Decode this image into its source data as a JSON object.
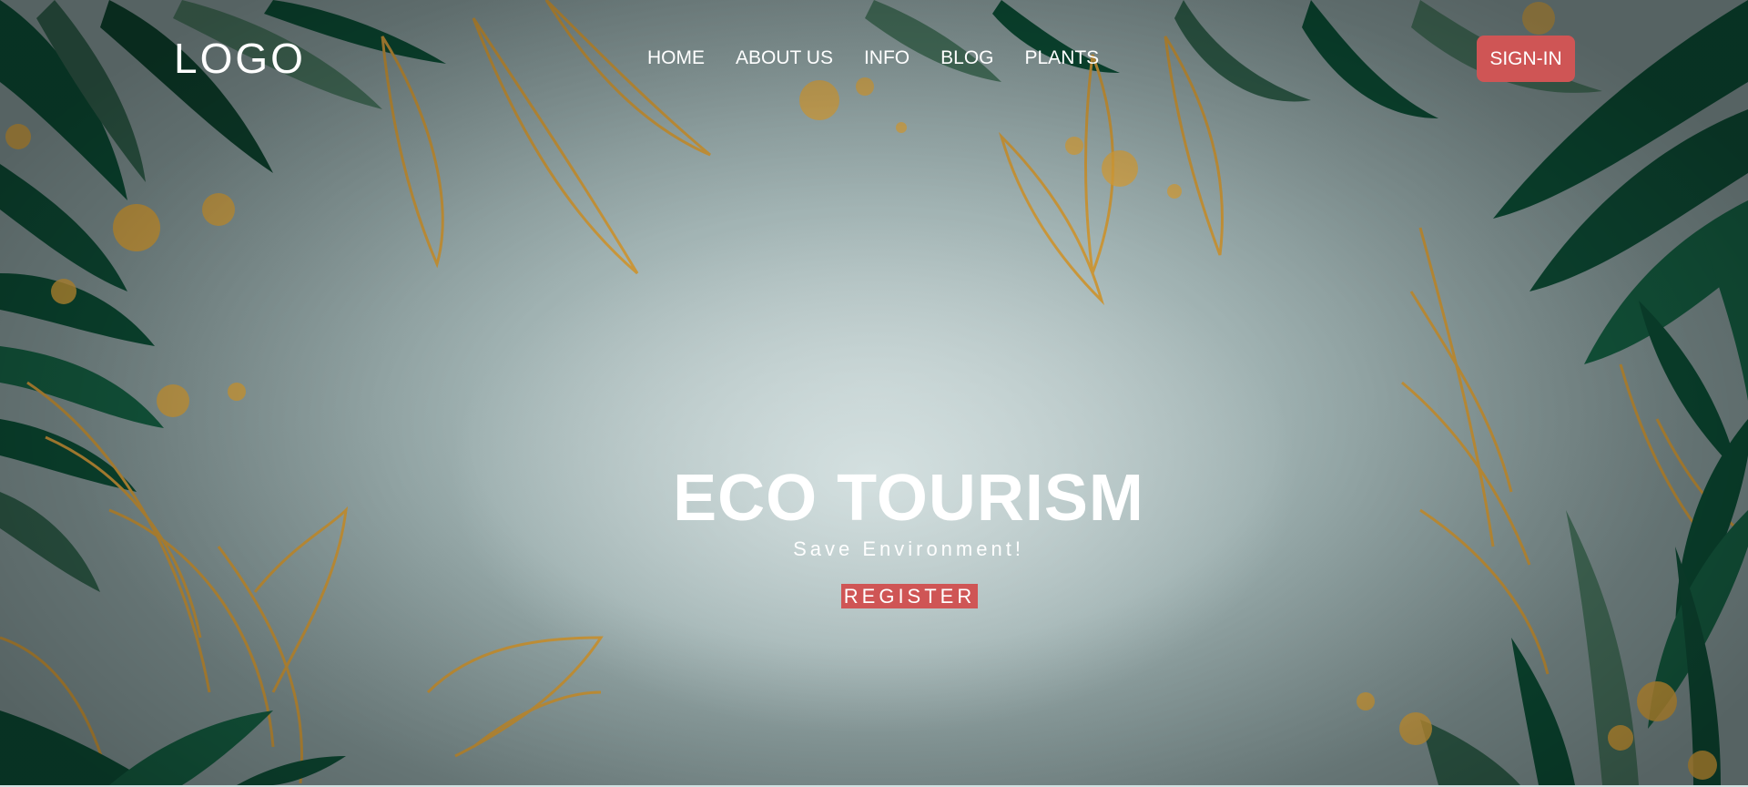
{
  "header": {
    "logo": "LOGO",
    "nav": [
      {
        "label": "HOME"
      },
      {
        "label": "ABOUT US"
      },
      {
        "label": "INFO"
      },
      {
        "label": "BLOG"
      },
      {
        "label": "PLANTS"
      }
    ],
    "signin_label": "SIGN-IN"
  },
  "hero": {
    "title": "ECO TOURISM",
    "subtitle": "Save Environment!",
    "register_label": "REGISTER"
  },
  "theme": {
    "accent": "#cf5555",
    "leaf_dark": "#0b4a33",
    "leaf_mid": "#4f7a60",
    "gold": "#d9a23a"
  }
}
